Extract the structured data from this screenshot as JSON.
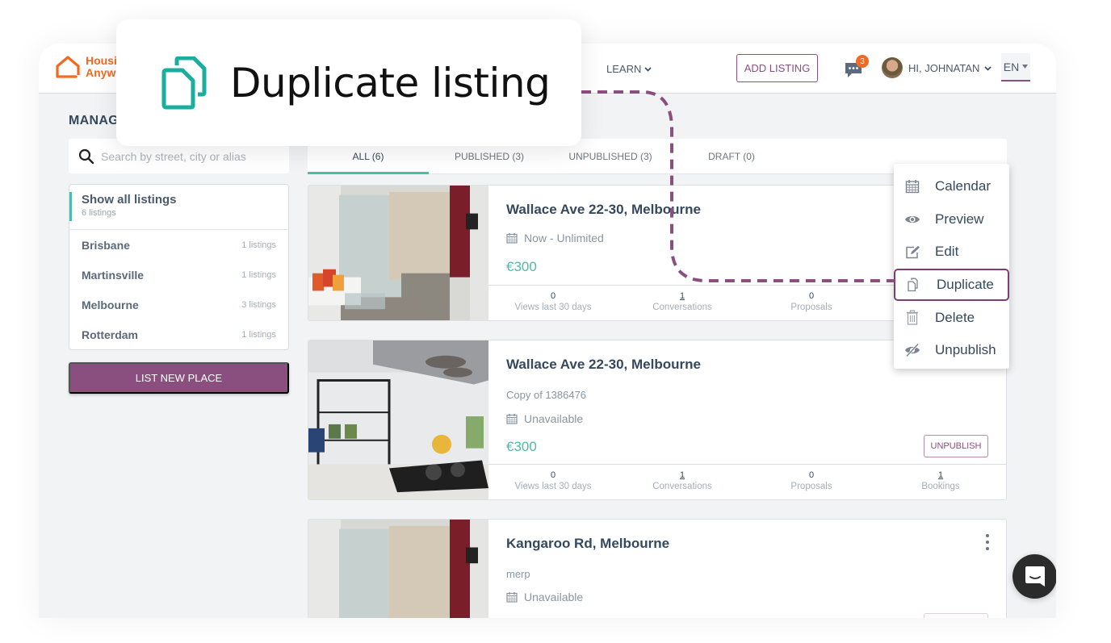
{
  "tooltip": {
    "title": "Duplicate listing",
    "icon": "duplicate-icon"
  },
  "header": {
    "logo_line1": "Housing",
    "logo_line2": "Anywhere",
    "nav_learn": "LEARN",
    "add_listing": "ADD LISTING",
    "messages_badge": "3",
    "user_greeting": "HI, JOHNATAN",
    "language": "EN"
  },
  "page": {
    "heading": "MANAGE LISTINGS"
  },
  "search": {
    "placeholder": "Search by street, city or alias",
    "value": ""
  },
  "cities": {
    "all": {
      "label": "Show all listings",
      "count": "6 listings"
    },
    "items": [
      {
        "name": "Brisbane",
        "count": "1 listings"
      },
      {
        "name": "Martinsville",
        "count": "1 listings"
      },
      {
        "name": "Melbourne",
        "count": "3 listings"
      },
      {
        "name": "Rotterdam",
        "count": "1 listings"
      }
    ]
  },
  "list_new_place": "LIST NEW PLACE",
  "tabs": [
    {
      "label": "ALL (6)",
      "active": true
    },
    {
      "label": "PUBLISHED (3)",
      "active": false
    },
    {
      "label": "UNPUBLISHED (3)",
      "active": false
    },
    {
      "label": "DRAFT (0)",
      "active": false
    }
  ],
  "listings": [
    {
      "title": "Wallace Ave 22-30, Melbourne",
      "availability": "Now - Unlimited",
      "price": "€300",
      "stats": [
        {
          "value": "0",
          "label": "Views last 30 days"
        },
        {
          "value": "1",
          "label": "Conversations"
        },
        {
          "value": "0",
          "label": "Proposals"
        }
      ]
    },
    {
      "title": "Wallace Ave 22-30, Melbourne",
      "note": "Copy of 1386476",
      "availability": "Unavailable",
      "price": "€300",
      "action": "UNPUBLISH",
      "stats": [
        {
          "value": "0",
          "label": "Views last 30 days"
        },
        {
          "value": "1",
          "label": "Conversations"
        },
        {
          "value": "0",
          "label": "Proposals"
        },
        {
          "value": "1",
          "label": "Bookings"
        }
      ]
    },
    {
      "title": "Kangaroo Rd, Melbourne",
      "note": "merp",
      "availability": "Unavailable"
    }
  ],
  "context_menu": {
    "items": [
      {
        "label": "Calendar",
        "icon": "calendar-icon"
      },
      {
        "label": "Preview",
        "icon": "eye-icon"
      },
      {
        "label": "Edit",
        "icon": "edit-icon"
      },
      {
        "label": "Duplicate",
        "icon": "duplicate-icon",
        "highlighted": true
      },
      {
        "label": "Delete",
        "icon": "trash-icon"
      },
      {
        "label": "Unpublish",
        "icon": "eye-slash-icon"
      }
    ]
  },
  "colors": {
    "brand": "#8b4f7f",
    "accent": "#4fb9aa",
    "logo": "#f26a21",
    "badge": "#f26a21"
  }
}
